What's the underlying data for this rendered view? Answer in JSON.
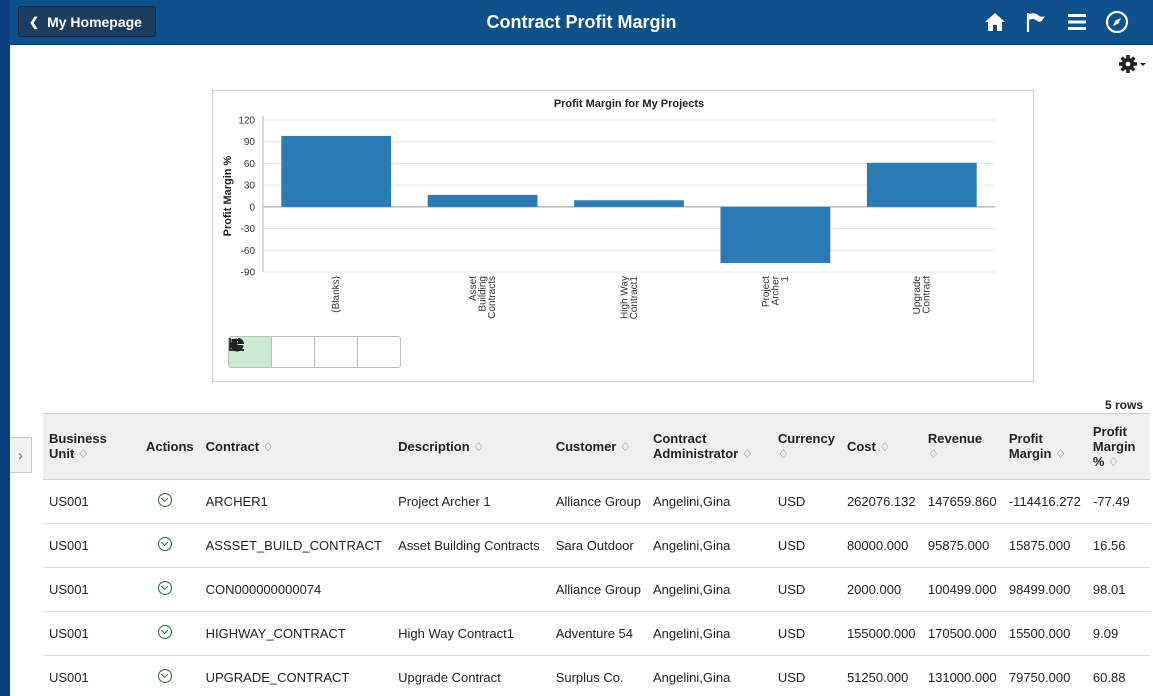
{
  "header": {
    "back_label": "My Homepage",
    "title": "Contract Profit Margin",
    "icons": [
      "home-icon",
      "flag-icon",
      "menu-icon",
      "compass-icon"
    ]
  },
  "settings_icon": "gear-icon",
  "chart_data": {
    "type": "bar",
    "title": "Profit Margin for My Projects",
    "xlabel": "",
    "ylabel": "Profit Margin %",
    "categories": [
      "(Blanks)",
      "Asset Building Contracts",
      "High Way Contract1",
      "Project Archer 1",
      "Upgrade Contract"
    ],
    "category_lines": [
      [
        "(Blanks)"
      ],
      [
        "Asset",
        "Building",
        "Contracts"
      ],
      [
        "High Way",
        "Contract1"
      ],
      [
        "Project",
        "Archer",
        "1"
      ],
      [
        "Upgrade",
        "Contract"
      ]
    ],
    "values": [
      98.01,
      16.56,
      9.09,
      -77.49,
      60.88
    ],
    "ylim": [
      -90,
      120
    ],
    "yticks": [
      120,
      90,
      60,
      30,
      0,
      -30,
      -60,
      -90
    ],
    "grid": true,
    "color": "#2a7ab5"
  },
  "chart_type_buttons": [
    "bar-chart-icon",
    "line-chart-icon",
    "pie-chart-icon",
    "horizontal-bar-chart-icon"
  ],
  "table": {
    "row_count": "5 rows",
    "columns": {
      "business_unit": [
        "Business",
        "Unit"
      ],
      "actions": "Actions",
      "contract": "Contract",
      "description": "Description",
      "customer": "Customer",
      "contract_admin": [
        "Contract",
        "Administrator"
      ],
      "currency": "Currency",
      "cost": "Cost",
      "revenue": "Revenue",
      "profit_margin": [
        "Profit",
        "Margin"
      ],
      "profit_margin_pct": [
        "Profit",
        "Margin",
        "%"
      ]
    },
    "rows": [
      {
        "business_unit": "US001",
        "contract": "ARCHER1",
        "description": "Project Archer 1",
        "customer": "Alliance Group",
        "contract_admin": "Angelini,Gina",
        "currency": "USD",
        "cost": "262076.132",
        "revenue": "147659.860",
        "profit_margin": "-114416.272",
        "profit_margin_pct": "-77.49"
      },
      {
        "business_unit": "US001",
        "contract": "ASSSET_BUILD_CONTRACT",
        "description": "Asset Building Contracts",
        "customer": "Sara Outdoor",
        "contract_admin": "Angelini,Gina",
        "currency": "USD",
        "cost": "80000.000",
        "revenue": "95875.000",
        "profit_margin": "15875.000",
        "profit_margin_pct": "16.56"
      },
      {
        "business_unit": "US001",
        "contract": "CON000000000074",
        "description": "",
        "customer": "Alliance Group",
        "contract_admin": "Angelini,Gina",
        "currency": "USD",
        "cost": "2000.000",
        "revenue": "100499.000",
        "profit_margin": "98499.000",
        "profit_margin_pct": "98.01"
      },
      {
        "business_unit": "US001",
        "contract": "HIGHWAY_CONTRACT",
        "description": "High Way Contract1",
        "customer": "Adventure 54",
        "contract_admin": "Angelini,Gina",
        "currency": "USD",
        "cost": "155000.000",
        "revenue": "170500.000",
        "profit_margin": "15500.000",
        "profit_margin_pct": "9.09"
      },
      {
        "business_unit": "US001",
        "contract": "UPGRADE_CONTRACT",
        "description": "Upgrade Contract",
        "customer": "Surplus Co.",
        "contract_admin": "Angelini,Gina",
        "currency": "USD",
        "cost": "51250.000",
        "revenue": "131000.000",
        "profit_margin": "79750.000",
        "profit_margin_pct": "60.88"
      }
    ]
  }
}
